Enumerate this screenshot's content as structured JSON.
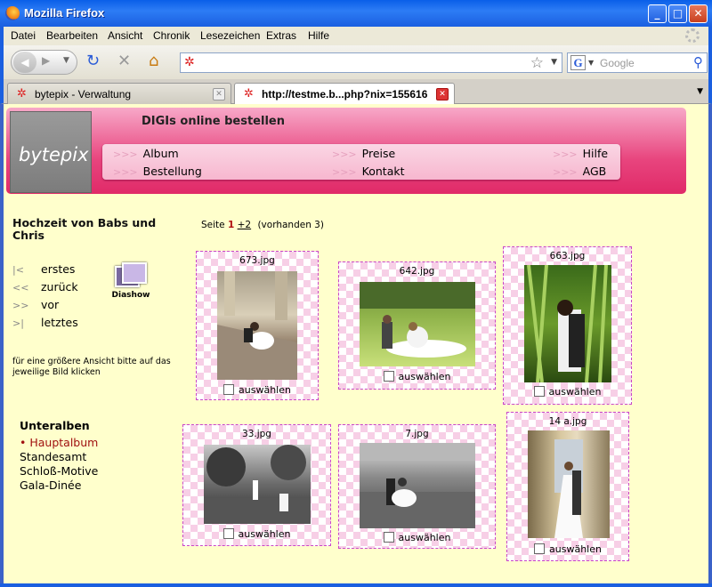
{
  "window": {
    "title": "Mozilla Firefox"
  },
  "menu": [
    "Datei",
    "Bearbeiten",
    "Ansicht",
    "Chronik",
    "Lesezeichen",
    "Extras",
    "Hilfe"
  ],
  "search": {
    "placeholder": "Google"
  },
  "tabs": [
    {
      "label": "bytepix - Verwaltung"
    },
    {
      "label": "http://testme.b...php?nix=155616"
    }
  ],
  "site": {
    "logo": "bytepix",
    "header_title": "DIGIs online bestellen",
    "nav": {
      "prefix": ">>>",
      "album": "Album",
      "preise": "Preise",
      "hilfe": "Hilfe",
      "bestellung": "Bestellung",
      "kontakt": "Kontakt",
      "agb": "AGB"
    }
  },
  "sidebar": {
    "album_title": "Hochzeit von Babs und Chris",
    "pager": [
      {
        "sym": "|<",
        "label": "erstes"
      },
      {
        "sym": "<<",
        "label": "zurück"
      },
      {
        "sym": ">>",
        "label": "vor"
      },
      {
        "sym": ">|",
        "label": "letztes"
      }
    ],
    "diashow": "Diashow",
    "hint": "für eine größere Ansicht bitte auf das jeweilige Bild klicken",
    "subalben_title": "Unteralben",
    "subalben": [
      "Hauptalbum",
      "Standesamt",
      "Schloß-Motive",
      "Gala-Dinée"
    ]
  },
  "paging": {
    "prefix": "Seite",
    "current": "1",
    "next": "+2",
    "info": "(vorhanden 3)"
  },
  "select_label": "auswählen",
  "photos": [
    {
      "filename": "673.jpg"
    },
    {
      "filename": "642.jpg"
    },
    {
      "filename": "663.jpg"
    },
    {
      "filename": "33.jpg"
    },
    {
      "filename": "7.jpg"
    },
    {
      "filename": "14 a.jpg"
    }
  ]
}
